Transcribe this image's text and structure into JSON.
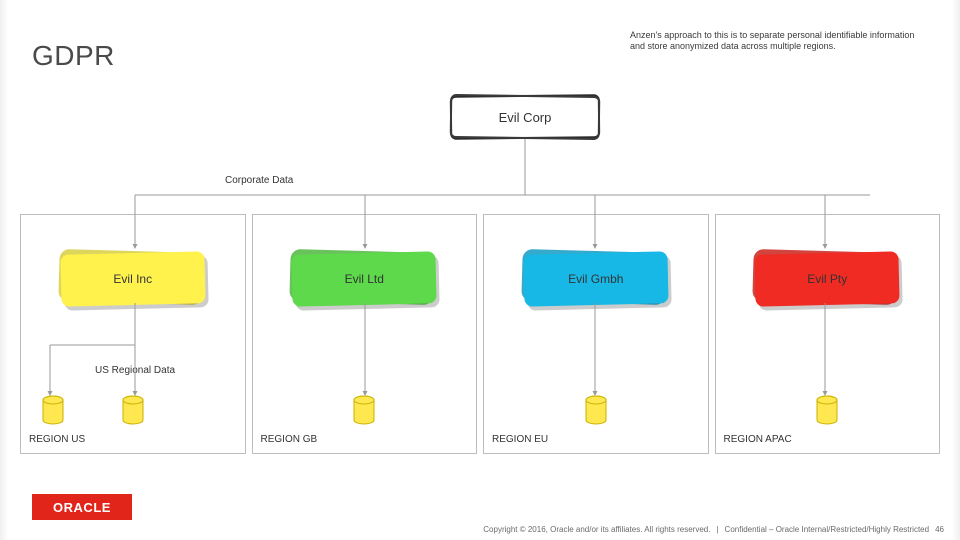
{
  "title": "GDPR",
  "blurb": "Anzen's approach to this is to separate personal identifiable information and store anonymized data across multiple regions.",
  "corp_box": "Evil Corp",
  "corporate_data_label": "Corporate Data",
  "us_regional_data_label": "US Regional Data",
  "entities": [
    {
      "name": "Evil Inc",
      "fill": "#fff24d",
      "region_label": "REGION US"
    },
    {
      "name": "Evil Ltd",
      "fill": "#5dd94b",
      "region_label": "REGION GB"
    },
    {
      "name": "Evil Gmbh",
      "fill": "#17b7e6",
      "region_label": "REGION EU"
    },
    {
      "name": "Evil Pty",
      "fill": "#ef2b23",
      "region_label": "REGION APAC"
    }
  ],
  "oracle_logo_text": "ORACLE",
  "footer_copyright": "Copyright © 2016, Oracle and/or its affiliates. All rights reserved.",
  "footer_confidential": "Confidential – Oracle Internal/Restricted/Highly Restricted",
  "page_number": "46"
}
